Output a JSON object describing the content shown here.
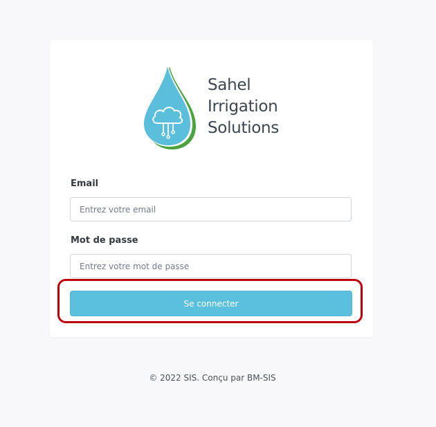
{
  "brand": {
    "line1": "Sahel",
    "line2": "Irrigation",
    "line3": "Solutions",
    "logo_icon": "water-drop-cloud-icon"
  },
  "form": {
    "email_label": "Email",
    "email_placeholder": "Entrez votre email",
    "email_value": "",
    "password_label": "Mot de passe",
    "password_placeholder": "Entrez votre mot de passe",
    "password_value": "",
    "submit_label": "Se connecter"
  },
  "footer": {
    "text": "© 2022 SIS. Conçu par BM-SIS"
  },
  "colors": {
    "button": "#5bc0de",
    "highlight": "#c0000b",
    "brand_text": "#3c4650",
    "drop_blue": "#5bbfdc",
    "drop_green": "#4aa33e"
  }
}
